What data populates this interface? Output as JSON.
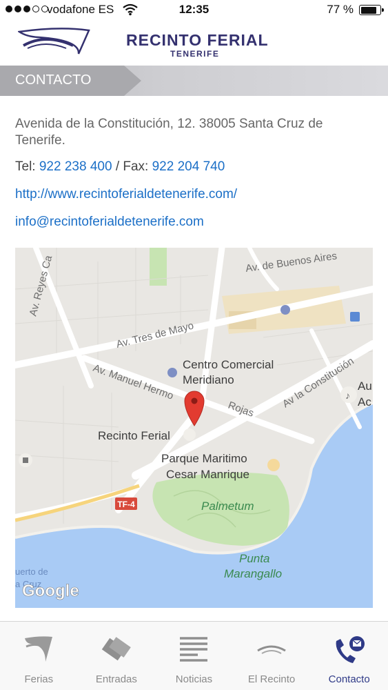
{
  "status_bar": {
    "carrier": "vodafone ES",
    "time": "12:35",
    "battery_text": "77 %",
    "battery_level": 0.77,
    "signal_bars_filled": 3,
    "signal_bars_total": 5
  },
  "header": {
    "title": "RECINTO FERIAL",
    "subtitle": "TENERIFE",
    "brand_color": "#34316f"
  },
  "section": {
    "title": "CONTACTO"
  },
  "contact": {
    "address": "Avenida de la Constitución, 12. 38005 Santa Cruz de Tenerife.",
    "tel_label": "Tel:",
    "tel": "922 238 400",
    "fax_label": "/ Fax:",
    "fax": "922 204 740",
    "website": "http://www.recintoferialdetenerife.com/",
    "email": "info@recintoferialdetenerife.com",
    "link_color": "#1b6fc7"
  },
  "map": {
    "streets": {
      "reyes": "Av. Reyes Ca",
      "buenos_aires": "Av. de Buenos Aires",
      "tres_de_mayo": "Av. Tres de Mayo",
      "manuel": "Av. Manuel Hermo",
      "rojas": "Rojas",
      "constitucion": "Av la Constitución",
      "tf4": "TF-4"
    },
    "places": {
      "cc_line1": "Centro Comercial",
      "cc_line2": "Meridiano",
      "recinto": "Recinto Ferial",
      "parque_line1": "Parque Maritimo",
      "parque_line2": "Cesar Manrique",
      "palmetum": "Palmetum",
      "punta_line1": "Punta",
      "punta_line2": "Marangallo",
      "au_line1": "Au",
      "au_line2": "Ac",
      "puerto_line1": "uerto de",
      "puerto_line2": "a Cruz"
    },
    "attribution": "Google"
  },
  "tabs": [
    {
      "label": "Ferias",
      "icon": "ferias-icon",
      "active": false
    },
    {
      "label": "Entradas",
      "icon": "tickets-icon",
      "active": false
    },
    {
      "label": "Noticias",
      "icon": "news-icon",
      "active": false
    },
    {
      "label": "El Recinto",
      "icon": "venue-icon",
      "active": false
    },
    {
      "label": "Contacto",
      "icon": "contact-phone-icon",
      "active": true
    }
  ]
}
